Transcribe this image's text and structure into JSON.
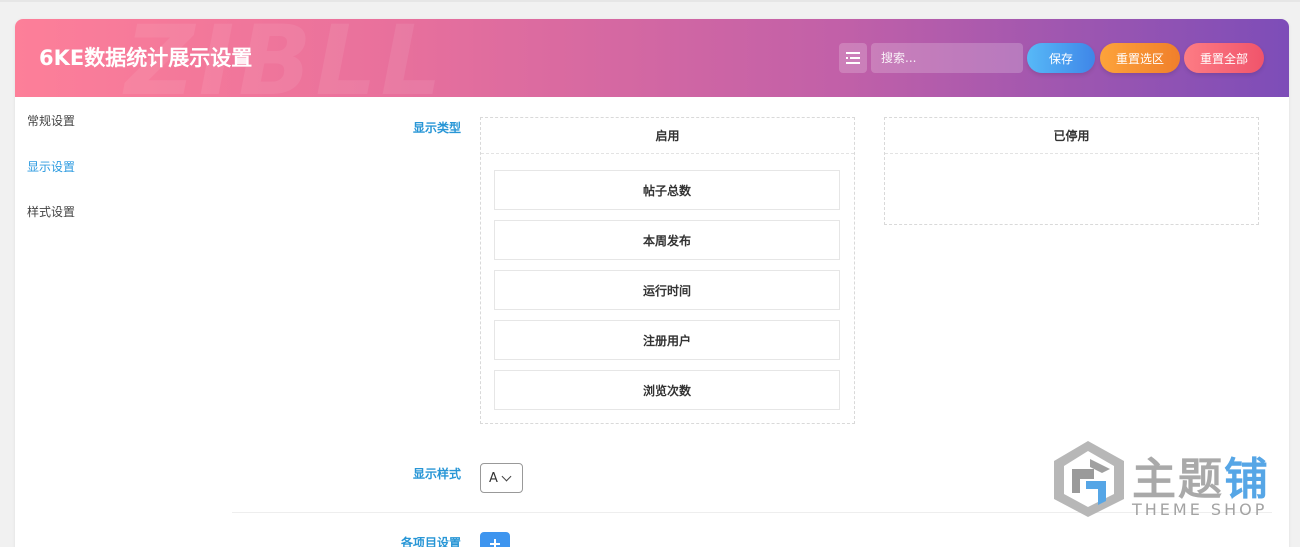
{
  "header": {
    "title": "6KE数据统计展示设置",
    "watermark": "ZIBLL",
    "search_placeholder": "搜索...",
    "save_label": "保存",
    "reset_section_label": "重置选区",
    "reset_all_label": "重置全部"
  },
  "sidebar": {
    "items": [
      {
        "label": "常规设置",
        "active": false
      },
      {
        "label": "显示设置",
        "active": true
      },
      {
        "label": "样式设置",
        "active": false
      }
    ]
  },
  "display_type": {
    "label": "显示类型",
    "enabled_title": "启用",
    "disabled_title": "已停用",
    "enabled_items": [
      "帖子总数",
      "本周发布",
      "运行时间",
      "注册用户",
      "浏览次数"
    ],
    "disabled_items": []
  },
  "display_style": {
    "label": "显示样式",
    "selected": "A"
  },
  "item_settings": {
    "label": "各项目设置"
  },
  "brand_logo": {
    "name": "主题铺",
    "name_plain": "主题",
    "name_accent": "铺",
    "subtitle": "THEME SHOP",
    "colors": {
      "gray": "#a9a9a9",
      "blue": "#56a6e6"
    }
  },
  "colors": {
    "header_gradient": [
      "#fd7f99",
      "#7d4db8"
    ],
    "accent": "#2896d6",
    "save": "#3f86e8",
    "reset_section": "#f07f2b",
    "reset_all": "#f0546b"
  }
}
